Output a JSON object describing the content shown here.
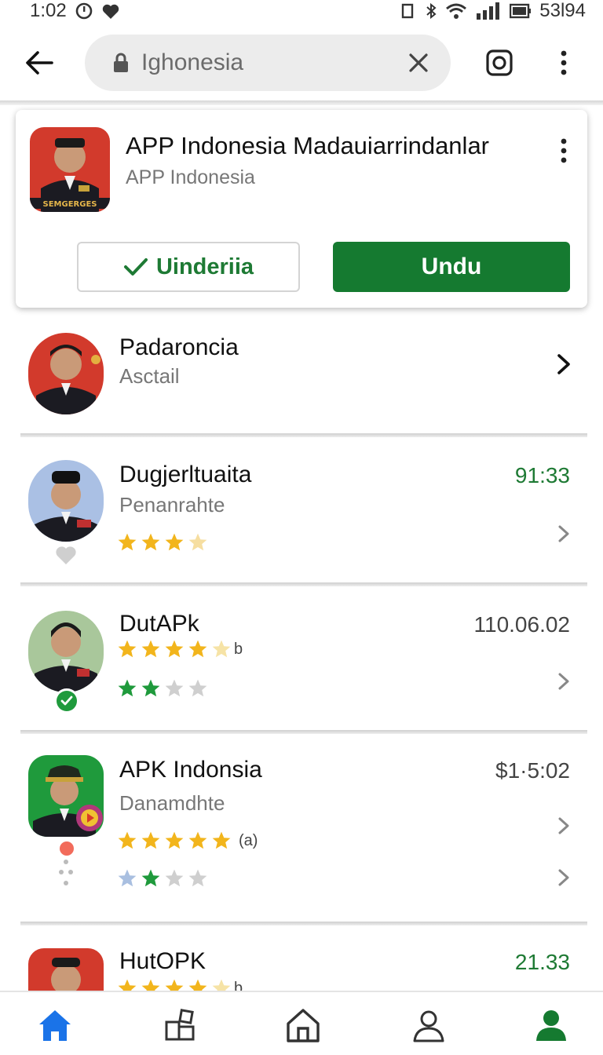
{
  "status": {
    "time": "1:02",
    "battery": "53l94"
  },
  "search": {
    "query": "Ighonesia"
  },
  "featured": {
    "title": "APP Indonesia  Madauiarrindanlar",
    "subtitle": "APP Indonesia",
    "badge_text": "SEMGERGES",
    "secondary_button": "Uinderiia",
    "primary_button": "Undu"
  },
  "items": [
    {
      "title": "Padaroncia",
      "subtitle": "Asctail",
      "value": ""
    },
    {
      "title": "Dugjerltuaita",
      "subtitle": "Penanrahte",
      "value": "91:33",
      "value_color": "#1e7a34",
      "rating": 3.5
    },
    {
      "title": "DutAPk",
      "subtitle": "",
      "value": "110.06.02",
      "value_color": "#444444",
      "rating_suffix": "b",
      "rating": 4.5,
      "rating2": 2
    },
    {
      "title": "APK Indonsia",
      "subtitle": "Danamdhte",
      "value": "$1·5:02",
      "value_color": "#444444",
      "rating_suffix": "(a)",
      "rating": 5,
      "rating2": 2
    },
    {
      "title": "HutOPK",
      "subtitle": "",
      "value": "21.33",
      "value_color": "#1e7a34",
      "rating_suffix": "b"
    }
  ],
  "colors": {
    "accent_green": "#157a30",
    "star_gold": "#f2b51c",
    "star_green": "#1f9a3c",
    "nav_home_blue": "#1a73e8"
  },
  "nav": [
    "home-icon",
    "apps-icon",
    "house-icon",
    "person-outline-icon",
    "person-filled-icon"
  ]
}
